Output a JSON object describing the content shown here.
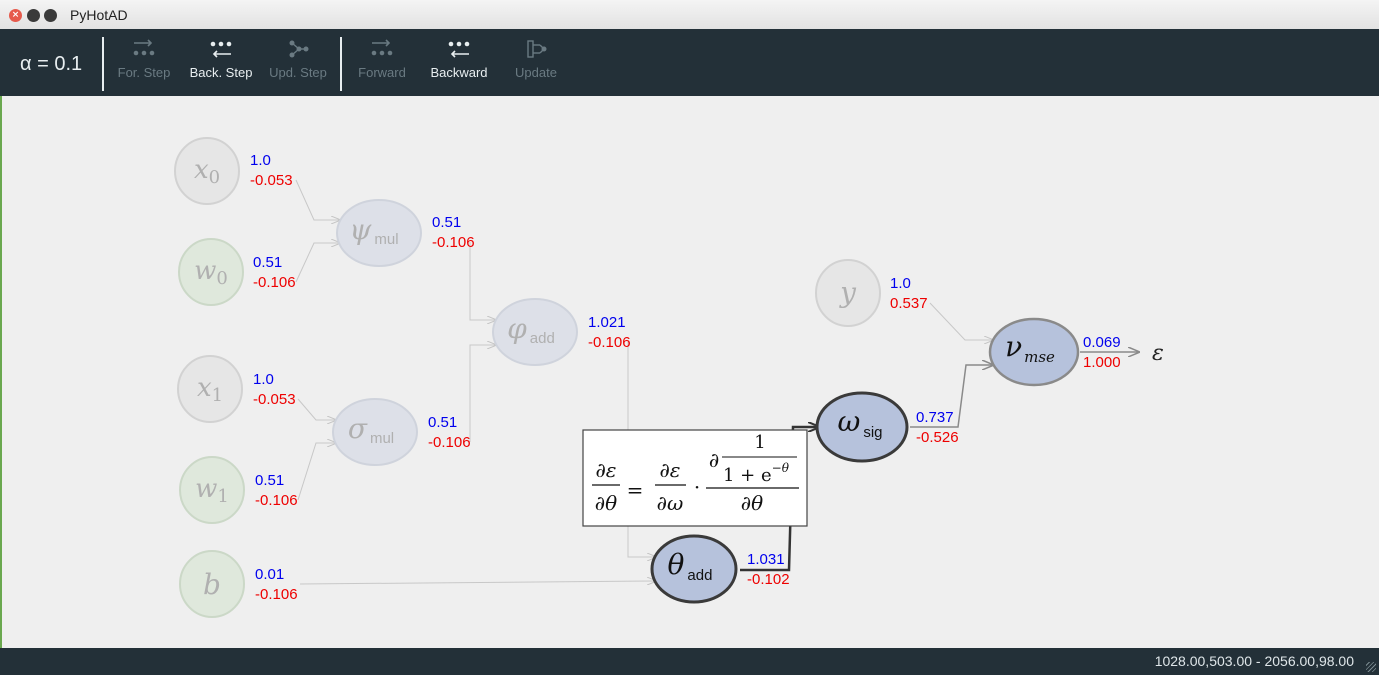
{
  "window": {
    "title": "PyHotAD"
  },
  "toolbar": {
    "alpha_label": "α = 0.1",
    "buttons": [
      {
        "label": "For. Step",
        "icon": "forward-step-icon",
        "enabled": false
      },
      {
        "label": "Back. Step",
        "icon": "backward-step-icon",
        "enabled": true
      },
      {
        "label": "Upd. Step",
        "icon": "update-step-icon",
        "enabled": false
      },
      {
        "label": "Forward",
        "icon": "forward-icon",
        "enabled": false
      },
      {
        "label": "Backward",
        "icon": "backward-icon",
        "enabled": true
      },
      {
        "label": "Update",
        "icon": "update-icon",
        "enabled": false
      }
    ]
  },
  "graph": {
    "nodes": {
      "x0": {
        "symbol": "x",
        "sub": "0",
        "value": "1.0",
        "grad": "-0.053"
      },
      "w0": {
        "symbol": "w",
        "sub": "0",
        "value": "0.51",
        "grad": "-0.106"
      },
      "psi": {
        "symbol": "ψ",
        "sub": "mul",
        "value": "0.51",
        "grad": "-0.106"
      },
      "x1": {
        "symbol": "x",
        "sub": "1",
        "value": "1.0",
        "grad": "-0.053"
      },
      "w1": {
        "symbol": "w",
        "sub": "1",
        "value": "0.51",
        "grad": "-0.106"
      },
      "sigma": {
        "symbol": "σ",
        "sub": "mul",
        "value": "0.51",
        "grad": "-0.106"
      },
      "phi": {
        "symbol": "φ",
        "sub": "add",
        "value": "1.021",
        "grad": "-0.106"
      },
      "b": {
        "symbol": "b",
        "sub": "",
        "value": "0.01",
        "grad": "-0.106"
      },
      "theta": {
        "symbol": "θ",
        "sub": "add",
        "value": "1.031",
        "grad": "-0.102"
      },
      "omega": {
        "symbol": "ω",
        "sub": "sig",
        "value": "0.737",
        "grad": "-0.526"
      },
      "y": {
        "symbol": "y",
        "sub": "",
        "value": "1.0",
        "grad": "0.537"
      },
      "nu": {
        "symbol": "ν",
        "sub": "mse",
        "value": "0.069",
        "grad": "1.000"
      }
    },
    "output_symbol": "ε",
    "formula": {
      "lhs_num": "∂ε",
      "lhs_den": "∂θ",
      "eq": "=",
      "mid_num": "∂ε",
      "mid_den": "∂ω",
      "dot": "·",
      "rhs_top": "1",
      "rhs_partial": "∂",
      "rhs_den_expr": "1 + e",
      "rhs_exp": "−θ",
      "rhs_den": "∂θ"
    },
    "colors": {
      "value": "#0000ee",
      "grad": "#ee0000",
      "active_fill": "#b6c2dc",
      "inactive_fill": "#dde0e8",
      "leaf_fill": "#e6e6e6",
      "param_fill": "#dfe8dc"
    }
  },
  "statusbar": {
    "coords": "1028.00,503.00 - 2056.00,98.00"
  }
}
